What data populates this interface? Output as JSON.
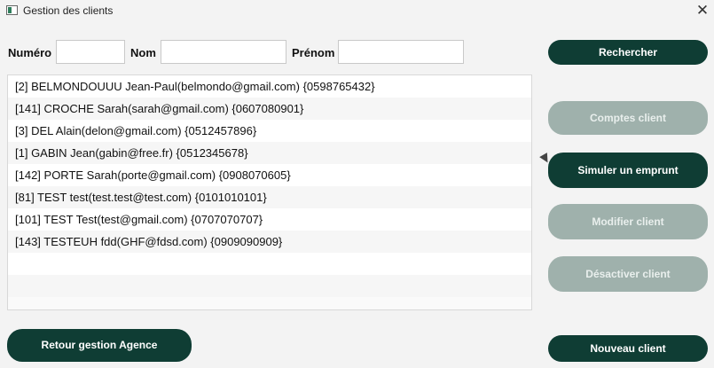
{
  "window": {
    "title": "Gestion des clients",
    "close": "✕"
  },
  "search": {
    "numero_label": "Numéro",
    "numero_value": "",
    "nom_label": "Nom",
    "nom_value": "",
    "prenom_label": "Prénom",
    "prenom_value": ""
  },
  "clients": [
    "[2]  BELMONDOUUU Jean-Paul(belmondo@gmail.com)  {0598765432}",
    "[141]  CROCHE Sarah(sarah@gmail.com)  {0607080901}",
    "[3]  DEL Alain(delon@gmail.com)  {0512457896}",
    "[1]  GABIN Jean(gabin@free.fr)  {0512345678}",
    "[142]  PORTE Sarah(porte@gmail.com)  {0908070605}",
    "[81]  TEST test(test.test@test.com)  {0101010101}",
    "[101]  TEST Test(test@gmail.com)  {0707070707}",
    "[143]  TESTEUH fdd(GHF@fdsd.com)  {0909090909}"
  ],
  "buttons": {
    "rechercher": "Rechercher",
    "comptes": "Comptes client",
    "simuler": "Simuler un emprunt",
    "modifier": "Modifier client",
    "desactiver": "Désactiver client",
    "retour": "Retour gestion Agence",
    "nouveau": "Nouveau client"
  },
  "colors": {
    "primary": "#0f3d34",
    "disabled": "#9fb1ac"
  }
}
